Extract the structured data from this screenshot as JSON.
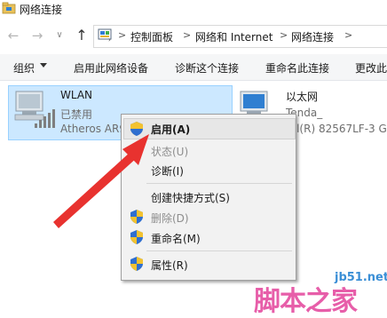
{
  "window": {
    "title": "网络连接"
  },
  "address": {
    "crumbs": [
      "控制面板",
      "网络和 Internet",
      "网络连接"
    ],
    "separator": ">"
  },
  "nav": {
    "back": "←",
    "forward": "→",
    "recent": "∨",
    "up": "↑"
  },
  "toolbar": {
    "organize": "组织",
    "enable_device": "启用此网络设备",
    "diagnose": "诊断这个连接",
    "rename": "重命名此连接",
    "more": "更改此"
  },
  "connections": [
    {
      "name": "WLAN",
      "status": "已禁用",
      "device": "Atheros AR9"
    },
    {
      "name": "以太网",
      "status": "Tenda_",
      "device": "tel(R) 82567LF-3 G"
    }
  ],
  "context_menu": {
    "items": [
      {
        "label": "启用(A)",
        "enabled": true,
        "shield": true,
        "bold": true
      },
      {
        "label": "状态(U)",
        "enabled": false,
        "shield": false
      },
      {
        "label": "诊断(I)",
        "enabled": true,
        "shield": false
      },
      {
        "label": "创建快捷方式(S)",
        "enabled": true,
        "shield": false
      },
      {
        "label": "删除(D)",
        "enabled": false,
        "shield": true
      },
      {
        "label": "重命名(M)",
        "enabled": true,
        "shield": true
      },
      {
        "label": "属性(R)",
        "enabled": true,
        "shield": true
      }
    ]
  },
  "watermark": {
    "site": "jb51.net",
    "text": "脚本之家"
  },
  "colors": {
    "selection_bg": "#cce8ff",
    "arrow": "#e8322f",
    "watermark": "#e23b97"
  }
}
